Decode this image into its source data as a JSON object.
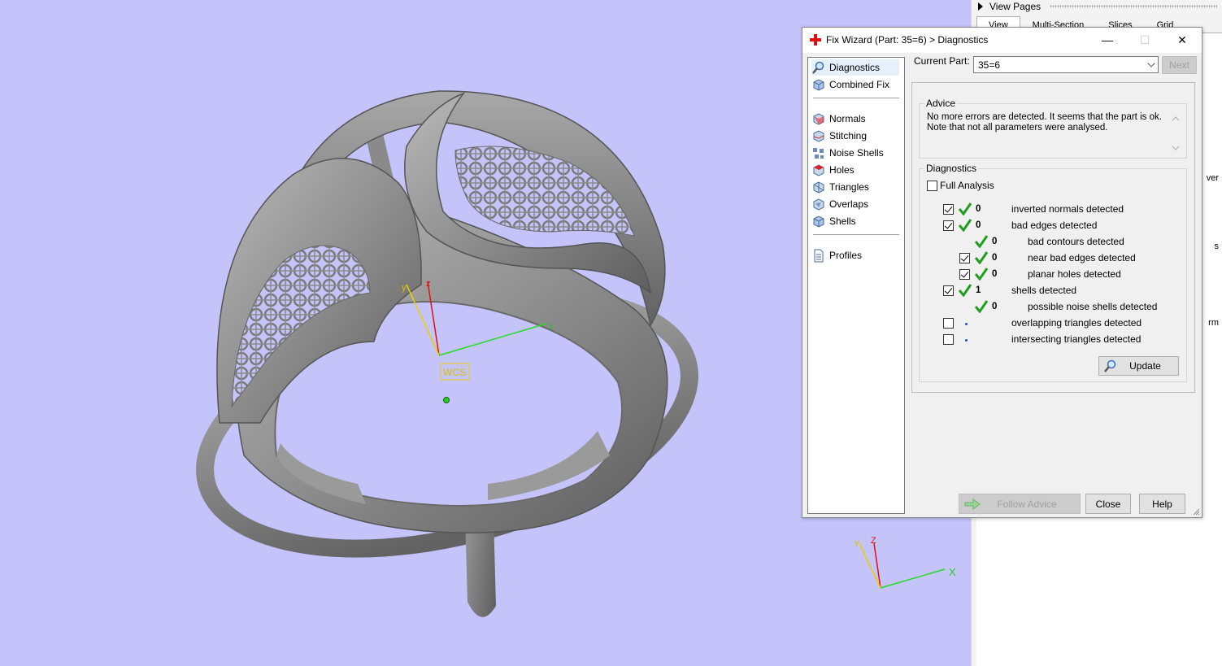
{
  "dialog": {
    "title": "Fix Wizard (Part: 35=6) > Diagnostics",
    "min_glyph": "—",
    "max_glyph": "☐",
    "close_glyph": "✕"
  },
  "nav": {
    "groups": [
      [
        {
          "label": "Diagnostics",
          "icon": "magnifier-icon",
          "selected": true
        },
        {
          "label": "Combined Fix",
          "icon": "combined-fix-icon",
          "selected": false
        }
      ],
      [
        {
          "label": "Normals",
          "icon": "normals-cube-icon"
        },
        {
          "label": "Stitching",
          "icon": "stitching-cube-icon"
        },
        {
          "label": "Noise Shells",
          "icon": "noise-shells-icon"
        },
        {
          "label": "Holes",
          "icon": "holes-cube-icon"
        },
        {
          "label": "Triangles",
          "icon": "triangles-cube-icon"
        },
        {
          "label": "Overlaps",
          "icon": "overlaps-cube-icon"
        },
        {
          "label": "Shells",
          "icon": "shells-cube-icon"
        }
      ],
      [
        {
          "label": "Profiles",
          "icon": "profiles-page-icon"
        }
      ]
    ]
  },
  "current_part": {
    "label": "Current Part:",
    "value": "35=6",
    "next_label": "Next"
  },
  "advice": {
    "title": "Advice",
    "text": "No more errors are detected. It seems that the part is ok. Note that not all parameters were analysed."
  },
  "diagnostics": {
    "title": "Diagnostics",
    "full_analysis_label": "Full Analysis",
    "full_analysis_checked": false,
    "rows": [
      {
        "checkbox": true,
        "checked": true,
        "status": "ok",
        "count": "0",
        "label": "inverted normals detected",
        "indent": 0
      },
      {
        "checkbox": true,
        "checked": true,
        "status": "ok",
        "count": "0",
        "label": "bad edges detected",
        "indent": 0
      },
      {
        "checkbox": false,
        "checked": false,
        "status": "ok",
        "count": "0",
        "label": "bad contours detected",
        "indent": 1
      },
      {
        "checkbox": true,
        "checked": true,
        "status": "ok",
        "count": "0",
        "label": "near bad edges detected",
        "indent": 1
      },
      {
        "checkbox": true,
        "checked": true,
        "status": "ok",
        "count": "0",
        "label": "planar holes detected",
        "indent": 1
      },
      {
        "checkbox": true,
        "checked": true,
        "status": "ok",
        "count": "1",
        "label": "shells detected",
        "indent": 0
      },
      {
        "checkbox": false,
        "checked": false,
        "status": "ok",
        "count": "0",
        "label": "possible noise shells detected",
        "indent": 1
      },
      {
        "checkbox": true,
        "checked": false,
        "status": "pending",
        "count": "",
        "label": "overlapping triangles detected",
        "indent": 0
      },
      {
        "checkbox": true,
        "checked": false,
        "status": "pending",
        "count": "",
        "label": "intersecting triangles detected",
        "indent": 0
      }
    ],
    "update_label": "Update"
  },
  "footer": {
    "follow_advice_label": "Follow Advice",
    "close_label": "Close",
    "help_label": "Help"
  },
  "side_panel": {
    "view_pages_label": "View Pages",
    "tabs": [
      "View",
      "Multi-Section",
      "Slices",
      "Grid"
    ],
    "active_tab": "View",
    "fragments": [
      "ver",
      "s",
      "rm"
    ]
  },
  "viewport": {
    "background": "#c4c4fb",
    "wcs_label": "WCS",
    "axis_x": "X",
    "axis_y": "Y",
    "axis_z": "Z",
    "axis_x_small": "x",
    "axis_y_small": "y",
    "axis_z_small": "z"
  },
  "colors": {
    "ok_green": "#1f9d1f",
    "accent_red": "#e01010",
    "axis_green": "#22dd22",
    "axis_yellow": "#e8d000"
  }
}
